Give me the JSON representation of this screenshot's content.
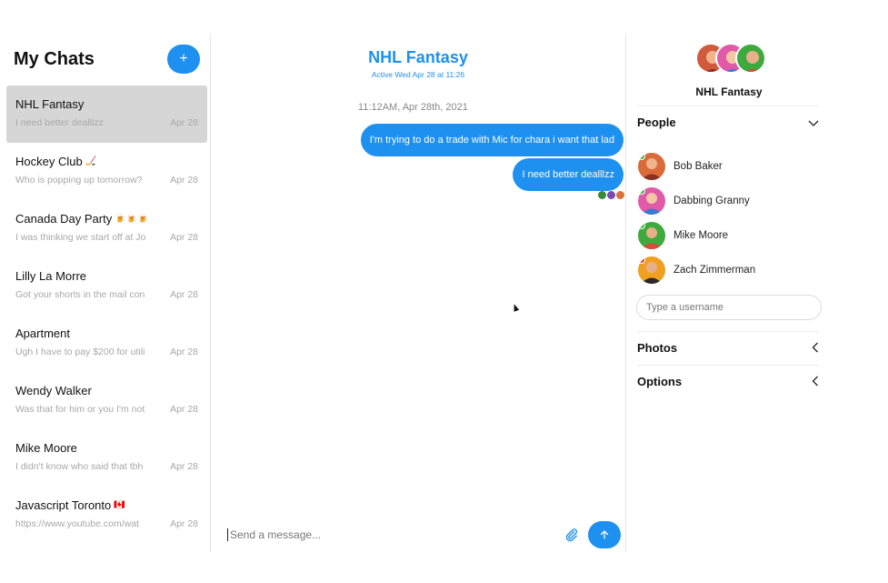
{
  "sidebar": {
    "title": "My Chats",
    "new_chat_icon": "plus",
    "chats": [
      {
        "name": "NHL Fantasy",
        "emoji": "",
        "preview": "I need better dealllzz",
        "date": "Apr 28",
        "active": true
      },
      {
        "name": "Hockey Club",
        "emoji": "🏒",
        "preview": "Who is popping up tomorrow?",
        "date": "Apr 28",
        "active": false
      },
      {
        "name": "Canada Day Party",
        "emoji": "🍺🍺🍺",
        "preview": "I was thinking we start off at Jo",
        "date": "Apr 28",
        "active": false
      },
      {
        "name": "Lilly La Morre",
        "emoji": "",
        "preview": "Got your shorts in the mail con",
        "date": "Apr 28",
        "active": false
      },
      {
        "name": "Apartment",
        "emoji": "",
        "preview": "Ugh I have to pay $200 for utili",
        "date": "Apr 28",
        "active": false
      },
      {
        "name": "Wendy Walker",
        "emoji": "",
        "preview": "Was that for him or you I'm not",
        "date": "Apr 28",
        "active": false
      },
      {
        "name": "Mike Moore",
        "emoji": "",
        "preview": "I didn't know who said that tbh",
        "date": "Apr 28",
        "active": false
      },
      {
        "name": "Javascript Toronto",
        "emoji": "🇨🇦",
        "preview": "https://www.youtube.com/wat",
        "date": "Apr 28",
        "active": false
      }
    ]
  },
  "conversation": {
    "title": "NHL Fantasy",
    "status": "Active Wed Apr 28 at 11:26",
    "timestamp": "11:12AM, Apr 28th, 2021",
    "messages": [
      {
        "text": "I'm trying to do a trade with Mic for chara i want that lad"
      },
      {
        "text": "I need better dealllzz"
      }
    ],
    "composer_placeholder": "Send a message...",
    "attach_icon": "paperclip",
    "send_icon": "arrow-up"
  },
  "details": {
    "title": "NHL Fantasy",
    "people_label": "People",
    "people": [
      {
        "name": "Bob Baker",
        "presence": "#43b543"
      },
      {
        "name": "Dabbing Granny",
        "presence": "#43b543"
      },
      {
        "name": "Mike Moore",
        "presence": "#43b543"
      },
      {
        "name": "Zach Zimmerman",
        "presence": "#e23a3a"
      }
    ],
    "username_placeholder": "Type a username",
    "photos_label": "Photos",
    "options_label": "Options"
  },
  "colors": {
    "accent": "#1e90f0",
    "active_chat_bg": "#d6d6d6"
  }
}
